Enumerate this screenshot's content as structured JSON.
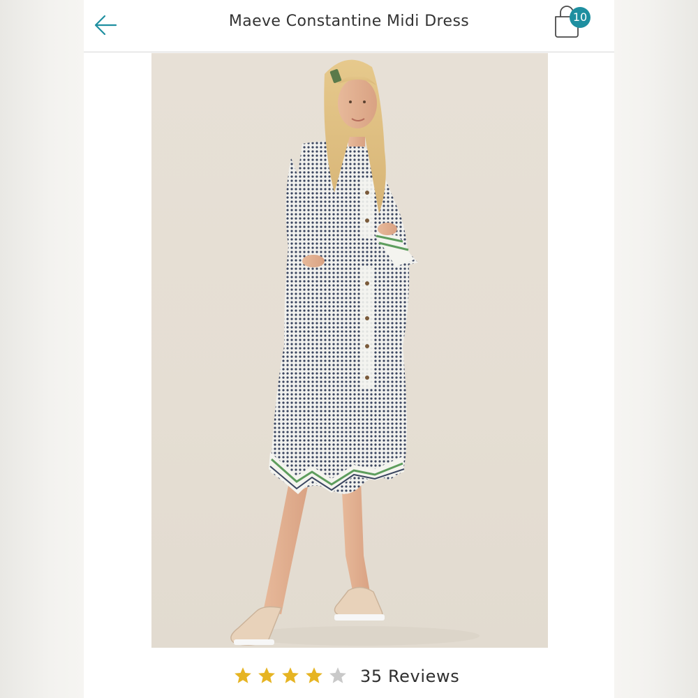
{
  "header": {
    "title": "Maeve Constantine Midi Dress",
    "back_icon": "arrow-left-icon",
    "cart_icon": "shopping-bag-icon",
    "cart_count": "10"
  },
  "product": {
    "image_alt": "Model wearing the dress"
  },
  "rating": {
    "stars_filled": 4,
    "stars_total": 5,
    "reviews_label": "35 Reviews"
  },
  "colors": {
    "accent": "#1e8fa0",
    "star_filled": "#e6b422",
    "star_empty": "#c9c9c9",
    "text": "#333333"
  }
}
